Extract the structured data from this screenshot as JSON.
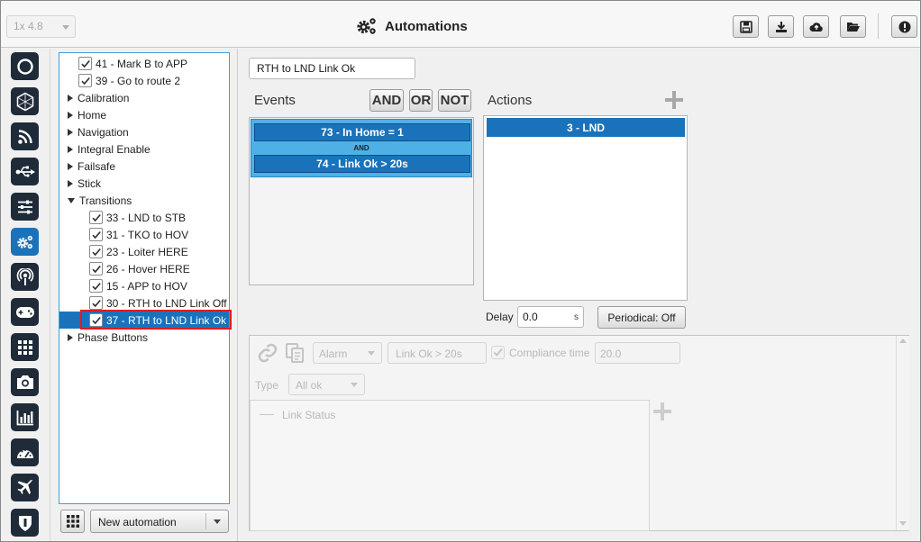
{
  "header": {
    "version_select": "1x 4.8",
    "title": "Automations",
    "buttons": [
      "save-icon",
      "download-icon",
      "cloud-upload-icon",
      "folder-open-icon",
      "info-icon"
    ]
  },
  "nav": {
    "icons": [
      "power-icon",
      "hexagon-icon",
      "rss-icon",
      "usb-icon",
      "sliders-icon",
      "cogs-icon",
      "broadcast-icon",
      "gamepad-icon",
      "grid-icon",
      "camera-icon",
      "bar-chart-icon",
      "gauge-icon",
      "airplane-icon",
      "shield-icon"
    ],
    "active_index": 5
  },
  "tree": {
    "items": [
      {
        "type": "check",
        "label": "41 - Mark B to APP",
        "checked": true,
        "level": 1
      },
      {
        "type": "check",
        "label": "39 - Go to route 2",
        "checked": true,
        "level": 1
      },
      {
        "type": "group",
        "label": "Calibration",
        "expanded": false
      },
      {
        "type": "group",
        "label": "Home",
        "expanded": false
      },
      {
        "type": "group",
        "label": "Navigation",
        "expanded": false
      },
      {
        "type": "group",
        "label": "Integral Enable",
        "expanded": false
      },
      {
        "type": "group",
        "label": "Failsafe",
        "expanded": false
      },
      {
        "type": "group",
        "label": "Stick",
        "expanded": false
      },
      {
        "type": "group",
        "label": "Transitions",
        "expanded": true
      },
      {
        "type": "check",
        "label": "33 - LND to STB",
        "checked": true,
        "level": 2
      },
      {
        "type": "check",
        "label": "31 - TKO to HOV",
        "checked": true,
        "level": 2
      },
      {
        "type": "check",
        "label": "23 - Loiter HERE",
        "checked": true,
        "level": 2
      },
      {
        "type": "check",
        "label": "26 - Hover HERE",
        "checked": true,
        "level": 2
      },
      {
        "type": "check",
        "label": "15 - APP to HOV",
        "checked": true,
        "level": 2
      },
      {
        "type": "check",
        "label": "30 - RTH to LND Link Off",
        "checked": true,
        "level": 2
      },
      {
        "type": "check",
        "label": "37 - RTH to LND Link Ok",
        "checked": true,
        "level": 2,
        "selected": true
      },
      {
        "type": "group",
        "label": "Phase Buttons",
        "expanded": false
      }
    ]
  },
  "bottom": {
    "new_automation": "New automation"
  },
  "automation": {
    "name": "RTH to LND Link Ok",
    "events_label": "Events",
    "and_btn": "AND",
    "or_btn": "OR",
    "not_btn": "NOT",
    "actions_label": "Actions",
    "events": [
      "73 - In Home = 1",
      "74 - Link Ok > 20s"
    ],
    "join": "AND",
    "actions": [
      "3 - LND"
    ],
    "delay_label": "Delay",
    "delay_value": "0.0",
    "delay_unit": "s",
    "periodical": "Periodical: Off"
  },
  "detail": {
    "alarm_select": "Alarm",
    "event_name": "Link Ok > 20s",
    "compliance_label": "Compliance time",
    "compliance_value": "20.0",
    "type_label": "Type",
    "type_select": "All ok",
    "list_item": "Link Status"
  },
  "colors": {
    "accent": "#1a73ba",
    "nav_bg": "#1f2b38",
    "highlight": "#e01b24"
  }
}
